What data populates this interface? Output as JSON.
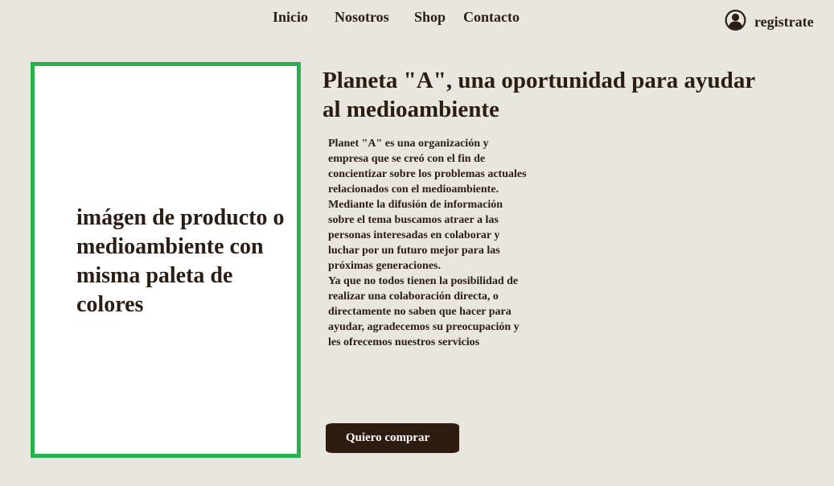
{
  "nav": {
    "items": [
      {
        "label": "Inicio"
      },
      {
        "label": "Nosotros"
      },
      {
        "label": "Shop"
      },
      {
        "label": "Contacto"
      }
    ]
  },
  "account": {
    "icon": "user-circle-icon",
    "label": "registrate"
  },
  "hero": {
    "image_placeholder_text": "imágen de producto o medioambiente con misma paleta de colores",
    "headline": "Planeta \"A\", una oportunidad para ayudar al medioambiente",
    "description": "Planet \"A\" es una organización y empresa que se creó con el fin de concientizar sobre los problemas actuales relacionados con el medioambiente. Mediante la difusión de información sobre el tema buscamos atraer a las personas interesadas en colaborar y luchar por un futuro mejor para las próximas generaciones.\n Ya que no todos tienen la posibilidad de realizar una colaboración directa, o directamente no saben que hacer para ayudar, agradecemos su preocupación y les ofrecemos nuestros servicios",
    "cta_label": "Quiero comprar"
  },
  "colors": {
    "background": "#e9e6df",
    "text": "#2b1d14",
    "image_border": "#27b24e",
    "button": "#2e1c10"
  }
}
